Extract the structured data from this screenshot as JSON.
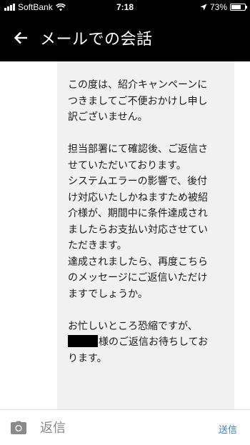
{
  "status_bar": {
    "carrier": "SoftBank",
    "time": "7:18",
    "battery_percent": "73%",
    "battery_level": 0.73
  },
  "header": {
    "title": "メールでの会話",
    "back_icon": "arrow-left-icon"
  },
  "message": {
    "lines": [
      "この度は、紹介キャンペーンに",
      "つきましてご不便おかけし申し",
      "訳ございません。",
      "",
      "担当部署にて確認後、ご返信さ",
      "せていただいております。",
      "システムエラーの影響で、後付",
      "け対応いたしかねますため被紹",
      "介様が、期間中に条件達成され",
      "ましたらお支払い対応させてい",
      "ただきます。",
      "達成されましたら、再度こちら",
      "のメッセージにご返信いただけ",
      "ますでしょうか。",
      "",
      "お忙しいところ恐縮ですが、",
      "様のご返信お待ちしてお",
      "ります。"
    ]
  },
  "composer": {
    "placeholder": "返信",
    "send_label": "送信",
    "camera_icon": "camera-icon"
  },
  "colors": {
    "header_bg": "#000000",
    "bubble_bg": "#f1f1f1",
    "accent": "#3b7ee0"
  }
}
